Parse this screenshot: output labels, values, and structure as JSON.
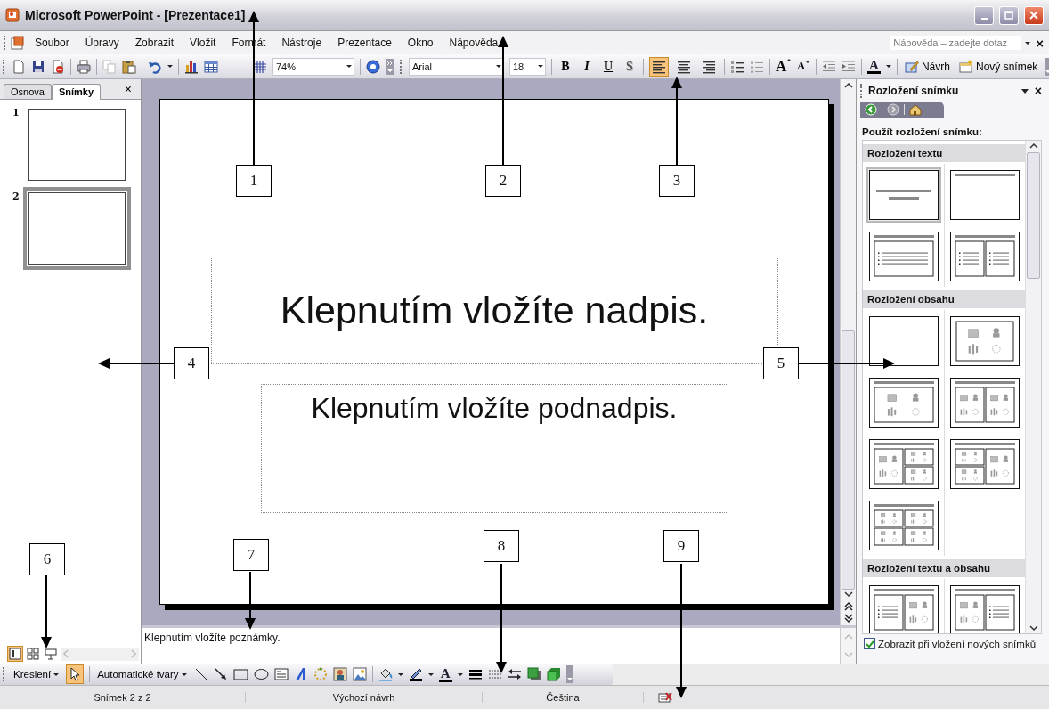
{
  "window": {
    "title": "Microsoft PowerPoint - [Prezentace1]"
  },
  "menu": {
    "items": [
      "Soubor",
      "Úpravy",
      "Zobrazit",
      "Vložit",
      "Formát",
      "Nástroje",
      "Prezentace",
      "Okno",
      "Nápověda"
    ],
    "help_placeholder": "Nápověda – zadejte dotaz",
    "close": "×"
  },
  "toolbar": {
    "zoom": "74%",
    "font": "Arial",
    "font_size": "18",
    "format_buttons": [
      {
        "kind": "bold",
        "label": "B"
      },
      {
        "kind": "italic",
        "label": "I"
      },
      {
        "kind": "underline",
        "label": "U"
      },
      {
        "kind": "shadow",
        "label": "S"
      }
    ],
    "alignment": [
      {
        "kind": "left",
        "selected": true
      },
      {
        "kind": "center",
        "selected": false
      },
      {
        "kind": "right",
        "selected": false
      }
    ],
    "grow_font": "A",
    "shrink_font": "A",
    "font_color": "A",
    "design_button": "Návrh",
    "new_slide_button": "Nový snímek"
  },
  "left_panel": {
    "tabs": [
      {
        "label": "Osnova",
        "selected": false
      },
      {
        "label": "Snímky",
        "selected": true
      }
    ],
    "close": "×",
    "thumbnails": [
      {
        "number": "1",
        "selected": false
      },
      {
        "number": "2",
        "selected": true
      }
    ],
    "views": [
      {
        "kind": "normal",
        "selected": true
      },
      {
        "kind": "sorter",
        "selected": false
      },
      {
        "kind": "show",
        "selected": false
      }
    ]
  },
  "slide": {
    "title_placeholder": "Klepnutím vložíte nadpis.",
    "subtitle_placeholder": "Klepnutím vložíte podnadpis."
  },
  "notes": {
    "text": "Klepnutím vložíte poznámky."
  },
  "task_pane": {
    "title": "Rozložení snímku",
    "close": "×",
    "heading": "Použít rozložení snímku:",
    "sections": [
      {
        "title": "Rozložení textu",
        "layouts": [
          {
            "kind": "title-slide",
            "selected": true
          },
          {
            "kind": "title-only",
            "selected": false
          },
          {
            "kind": "title-text",
            "selected": false
          },
          {
            "kind": "title-two-text",
            "selected": false
          }
        ]
      },
      {
        "title": "Rozložení obsahu",
        "layouts": [
          {
            "kind": "blank",
            "selected": false
          },
          {
            "kind": "content",
            "selected": false
          },
          {
            "kind": "title-content",
            "selected": false
          },
          {
            "kind": "title-two-content",
            "selected": false
          },
          {
            "kind": "title-content-two",
            "selected": false
          },
          {
            "kind": "title-two-content-right",
            "selected": false
          },
          {
            "kind": "title-four-content",
            "selected": false
          }
        ]
      },
      {
        "title": "Rozložení textu a obsahu",
        "layouts": [
          {
            "kind": "text-content",
            "selected": false
          },
          {
            "kind": "content-text",
            "selected": false
          }
        ]
      }
    ],
    "show_on_insert": {
      "label": "Zobrazit při vložení nových snímků",
      "checked": true
    }
  },
  "drawing_toolbar": {
    "draw_menu": "Kreslení",
    "autoshapes": "Automatické tvary",
    "font_color": "A"
  },
  "status_bar": [
    "Snímek 2 z 2",
    "Výchozí návrh",
    "Čeština"
  ],
  "callouts": [
    {
      "label": "1"
    },
    {
      "label": "2"
    },
    {
      "label": "3"
    },
    {
      "label": "4"
    },
    {
      "label": "5"
    },
    {
      "label": "6"
    },
    {
      "label": "7"
    },
    {
      "label": "8"
    },
    {
      "label": "9"
    }
  ]
}
